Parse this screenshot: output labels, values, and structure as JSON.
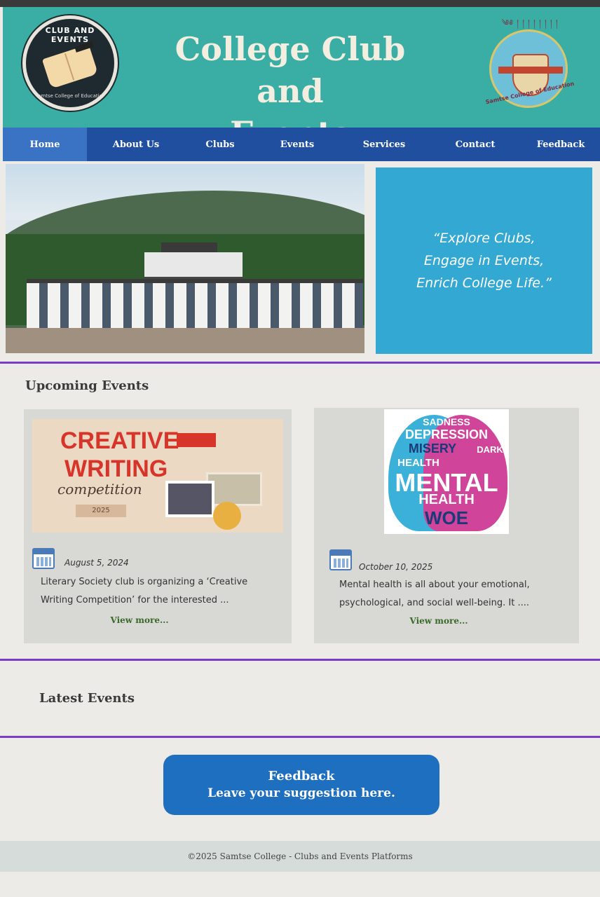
{
  "header": {
    "title_line1": "College Club and",
    "title_line2": "Events",
    "logo_left_text": "CLUB AND EVENTS",
    "logo_left_subtext": "Samtse College of Education",
    "logo_right_caption": "Samtse College of Education"
  },
  "nav": {
    "items": [
      {
        "label": "Home",
        "active": true
      },
      {
        "label": "About Us",
        "active": false
      },
      {
        "label": "Clubs",
        "active": false
      },
      {
        "label": "Events",
        "active": false
      },
      {
        "label": "Services",
        "active": false
      },
      {
        "label": "Contact",
        "active": false
      },
      {
        "label": "Feedback",
        "active": false
      }
    ]
  },
  "hero": {
    "quote_line1": "“Explore Clubs,",
    "quote_line2": "Engage in Events,",
    "quote_line3": "Enrich College Life.”"
  },
  "upcoming": {
    "title": "Upcoming Events",
    "cards": [
      {
        "image_text": [
          "CREATIVE",
          "WRITING",
          "competition",
          "2025"
        ],
        "date": "August 5, 2024",
        "desc_line1": "Literary Society club is organizing a ‘Creative",
        "desc_line2": "Writing Competition’ for the interested ...",
        "more": "View more..."
      },
      {
        "image_text": [
          "SADNESS",
          "DEPRESSION",
          "MISERY",
          "DARK",
          "HEALTH",
          "MENTAL",
          "HEALTH",
          "WOE"
        ],
        "date": "October 10, 2025",
        "desc_line1": "Mental health is all about your emotional,",
        "desc_line2": "psychological, and social well-being. It ....",
        "more": "View more..."
      }
    ]
  },
  "latest": {
    "title": "Latest Events"
  },
  "feedback": {
    "line1": "Feedback",
    "line2": "Leave your suggestion here."
  },
  "footer": {
    "text": "©2025 Samtse College - Clubs and Events Platforms"
  },
  "colors": {
    "header_bg": "#3aaea4",
    "nav_bg": "#1f4f9e",
    "nav_active": "#3a72c4",
    "quote_bg": "#33a8d2",
    "divider": "#7a3ec6",
    "button_bg": "#1f6fc0"
  }
}
